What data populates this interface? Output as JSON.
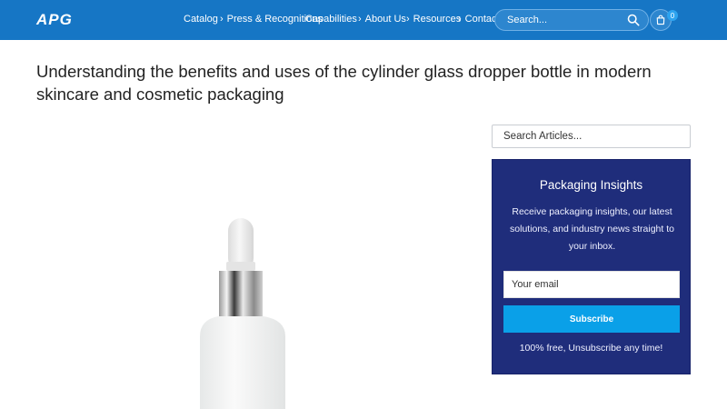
{
  "header": {
    "logo_text": "APG",
    "nav": [
      {
        "label": "Catalog",
        "chevron": false
      },
      {
        "label": "Press & Recognitions",
        "chevron": true
      },
      {
        "label": "Capabilities",
        "chevron": false
      },
      {
        "label": "About Us",
        "chevron": true
      },
      {
        "label": "Resources",
        "chevron": true
      },
      {
        "label": "Contact",
        "chevron": true
      }
    ],
    "search_placeholder": "Search...",
    "cart_count": "0",
    "colors": {
      "bar": "#1676c5",
      "badge": "#2ea4f0"
    }
  },
  "article": {
    "title": "Understanding the benefits and uses of the cylinder glass dropper bottle in modern skincare and cosmetic packaging",
    "image": "white-glass-dropper-bottle-with-silver-collar"
  },
  "sidebar": {
    "search_placeholder": "Search Articles...",
    "newsletter": {
      "title": "Packaging Insights",
      "description": "Receive packaging insights, our latest solutions, and industry news straight to your inbox.",
      "email_placeholder": "Your email",
      "button_label": "Subscribe",
      "footnote": "100% free, Unsubscribe any time!",
      "colors": {
        "panel": "#1f2d7b",
        "button": "#0aa0e8"
      }
    }
  }
}
